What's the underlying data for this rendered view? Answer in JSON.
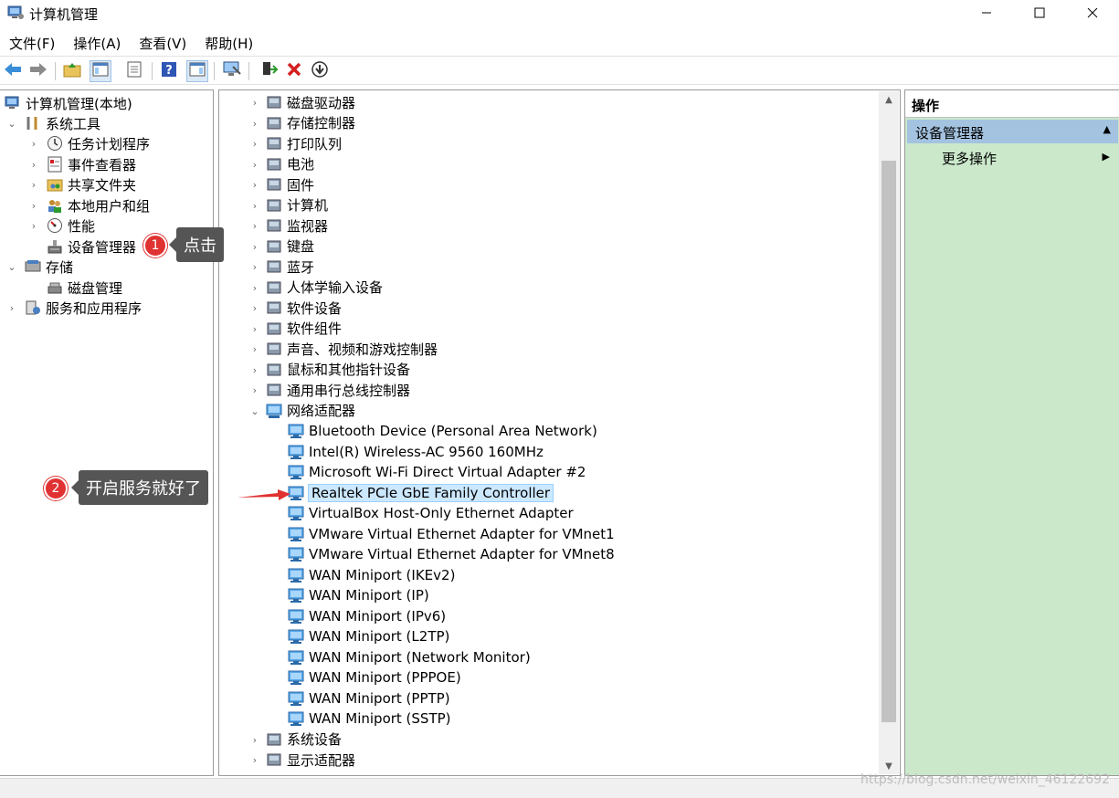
{
  "window": {
    "title": "计算机管理"
  },
  "menu": [
    "文件(F)",
    "操作(A)",
    "查看(V)",
    "帮助(H)"
  ],
  "left_tree": {
    "root": "计算机管理(本地)",
    "system_tools": "系统工具",
    "task_scheduler": "任务计划程序",
    "event_viewer": "事件查看器",
    "shared_folders": "共享文件夹",
    "local_users": "本地用户和组",
    "performance": "性能",
    "device_manager": "设备管理器",
    "storage": "存储",
    "disk_management": "磁盘管理",
    "services": "服务和应用程序"
  },
  "device_tree": {
    "categories_top": [
      "磁盘驱动器",
      "存储控制器",
      "打印队列",
      "电池",
      "固件",
      "计算机",
      "监视器",
      "键盘",
      "蓝牙",
      "人体学输入设备",
      "软件设备",
      "软件组件",
      "声音、视频和游戏控制器",
      "鼠标和其他指针设备",
      "通用串行总线控制器"
    ],
    "network_adapters": "网络适配器",
    "adapters": [
      "Bluetooth Device (Personal Area Network)",
      "Intel(R) Wireless-AC 9560 160MHz",
      "Microsoft Wi-Fi Direct Virtual Adapter #2",
      "Realtek PCIe GbE Family Controller",
      "VirtualBox Host-Only Ethernet Adapter",
      "VMware Virtual Ethernet Adapter for VMnet1",
      "VMware Virtual Ethernet Adapter for VMnet8",
      "WAN Miniport (IKEv2)",
      "WAN Miniport (IP)",
      "WAN Miniport (IPv6)",
      "WAN Miniport (L2TP)",
      "WAN Miniport (Network Monitor)",
      "WAN Miniport (PPPOE)",
      "WAN Miniport (PPTP)",
      "WAN Miniport (SSTP)"
    ],
    "categories_bottom": [
      "系统设备",
      "显示适配器"
    ]
  },
  "actions": {
    "header": "操作",
    "section": "设备管理器",
    "more": "更多操作"
  },
  "annotations": {
    "badge1": "1",
    "callout1": "点击",
    "badge2": "2",
    "callout2": "开启服务就好了"
  },
  "watermark": "https://blog.csdn.net/weixin_46122692"
}
